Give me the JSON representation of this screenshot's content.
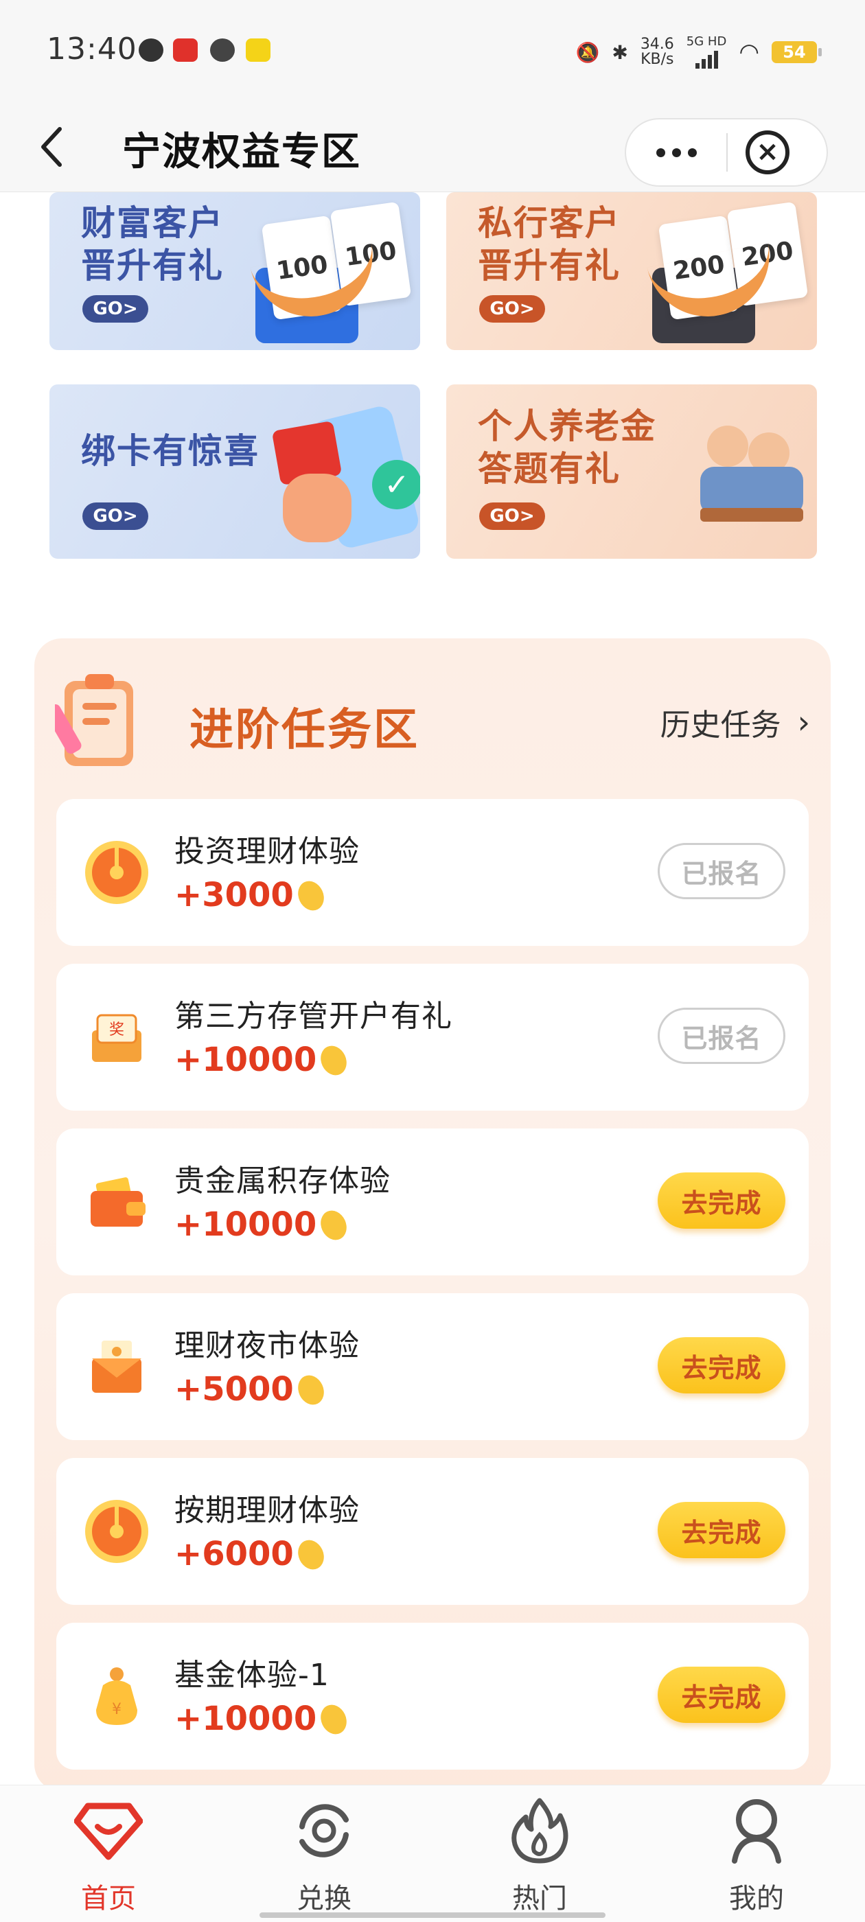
{
  "status_bar": {
    "time": "13:40",
    "net_speed_value": "34.6",
    "net_speed_unit": "KB/s",
    "network": "5G HD",
    "battery": "54"
  },
  "nav": {
    "title": "宁波权益专区",
    "back_icon": "chevron-left-icon",
    "more_icon": "more-dots-icon",
    "close_icon": "close-circle-icon"
  },
  "banners": [
    {
      "line1": "财富客户",
      "line2": "晋升有礼",
      "go": "GO>",
      "coupon": "100",
      "coupon2": "100",
      "theme": "#dbe5f7"
    },
    {
      "line1": "私行客户",
      "line2": "晋升有礼",
      "go": "GO>",
      "coupon": "200",
      "coupon2": "200",
      "theme": "#fbe2d0"
    },
    {
      "line1": "绑卡有惊喜",
      "line2": "",
      "go": "GO>",
      "theme": "#dbe5f7"
    },
    {
      "line1": "个人养老金",
      "line2": "答题有礼",
      "go": "GO>",
      "theme": "#fbe2d0"
    }
  ],
  "tasks_section": {
    "title": "进阶任务区",
    "history_label": "历史任务",
    "items": [
      {
        "name": "投资理财体验",
        "reward": "+3000",
        "button": "已报名",
        "status": "registered",
        "icon": "wheel-icon"
      },
      {
        "name": "第三方存管开户有礼",
        "reward": "+10000",
        "button": "已报名",
        "status": "registered",
        "icon": "prize-box-icon"
      },
      {
        "name": "贵金属积存体验",
        "reward": "+10000",
        "button": "去完成",
        "status": "todo",
        "icon": "wallet-icon"
      },
      {
        "name": "理财夜市体验",
        "reward": "+5000",
        "button": "去完成",
        "status": "todo",
        "icon": "envelope-icon"
      },
      {
        "name": "按期理财体验",
        "reward": "+6000",
        "button": "去完成",
        "status": "todo",
        "icon": "wheel-icon"
      },
      {
        "name": "基金体验-1",
        "reward": "+10000",
        "button": "去完成",
        "status": "todo",
        "icon": "money-bag-icon"
      }
    ]
  },
  "tab_bar": {
    "tabs": [
      {
        "label": "首页",
        "icon": "home-diamond-icon",
        "active": true
      },
      {
        "label": "兑换",
        "icon": "exchange-icon",
        "active": false
      },
      {
        "label": "热门",
        "icon": "flame-icon",
        "active": false
      },
      {
        "label": "我的",
        "icon": "user-icon",
        "active": false
      }
    ]
  },
  "colors": {
    "accent": "#e2362a",
    "reward_red": "#e23b1e",
    "section_title": "#d85e22",
    "button_yellow": "#fbc21c"
  }
}
